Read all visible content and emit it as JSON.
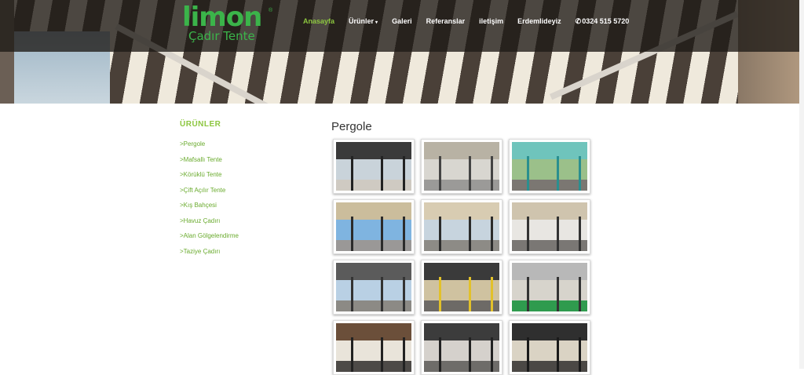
{
  "logo": {
    "word": "limon",
    "subtitle": "Çadır Tente",
    "registered": "®"
  },
  "nav": {
    "items": [
      {
        "label": "Anasayfa",
        "active": true
      },
      {
        "label": "Ürünler",
        "dropdown": true
      },
      {
        "label": "Galeri"
      },
      {
        "label": "Referanslar"
      },
      {
        "label": "iletişim"
      },
      {
        "label": "Erdemlideyiz"
      }
    ],
    "phone": "0324 515 5720",
    "phone_icon": "phone-icon"
  },
  "sidebar": {
    "title": "ÜRÜNLER",
    "items": [
      ">Pergole",
      ">Mafsallı Tente",
      ">Körüklü Tente",
      ">Çift Açılır Tente",
      ">Kış Bahçesi",
      ">Havuz Çadırı",
      ">Alan Gölgelendirme",
      ">Taziye Çadırı"
    ]
  },
  "content": {
    "title": "Pergole",
    "thumbnails": [
      {
        "label": "pergole-photo-1",
        "sky": "#c9d3da",
        "roof": "#3a3a3a",
        "ground": "#cfcac2",
        "post": "#222"
      },
      {
        "label": "pergole-photo-2",
        "sky": "#d8d6d0",
        "roof": "#b8b2a4",
        "ground": "#9b9a98",
        "post": "#444"
      },
      {
        "label": "pergole-photo-3",
        "sky": "#9bc08a",
        "roof": "#6fc4bc",
        "ground": "#7b7772",
        "post": "#2a8f8f"
      },
      {
        "label": "pergole-photo-4",
        "sky": "#7fb4e0",
        "roof": "#cbbd9c",
        "ground": "#9a9897",
        "post": "#2b2b2b"
      },
      {
        "label": "pergole-photo-5",
        "sky": "#c7d4de",
        "roof": "#d8ccb2",
        "ground": "#8d8b86",
        "post": "#2b2b2b"
      },
      {
        "label": "pergole-photo-6",
        "sky": "#e8e6e2",
        "roof": "#cfc4ae",
        "ground": "#7a7774",
        "post": "#333"
      },
      {
        "label": "pergole-photo-7",
        "sky": "#b9d0e4",
        "roof": "#5b5b5b",
        "ground": "#8c8a85",
        "post": "#333"
      },
      {
        "label": "pergole-photo-8",
        "sky": "#cfc2a0",
        "roof": "#3a3a3a",
        "ground": "#6d6a66",
        "post": "#e2c12a"
      },
      {
        "label": "pergole-photo-9",
        "sky": "#d7d4cc",
        "roof": "#b8b8b8",
        "ground": "#2f9b4e",
        "post": "#333"
      },
      {
        "label": "pergole-photo-10",
        "sky": "#e9e4da",
        "roof": "#6b4f3a",
        "ground": "#4d4a47",
        "post": "#222"
      },
      {
        "label": "pergole-photo-11",
        "sky": "#d5d1cc",
        "roof": "#3c3c3c",
        "ground": "#6e6c69",
        "post": "#222"
      },
      {
        "label": "pergole-photo-12",
        "sky": "#dad3c4",
        "roof": "#2f2f2f",
        "ground": "#4b4845",
        "post": "#1a1a1a"
      }
    ]
  },
  "colors": {
    "accent_green": "#8cc63f",
    "logo_green": "#3bb44a",
    "nav_text": "#ffffff"
  }
}
